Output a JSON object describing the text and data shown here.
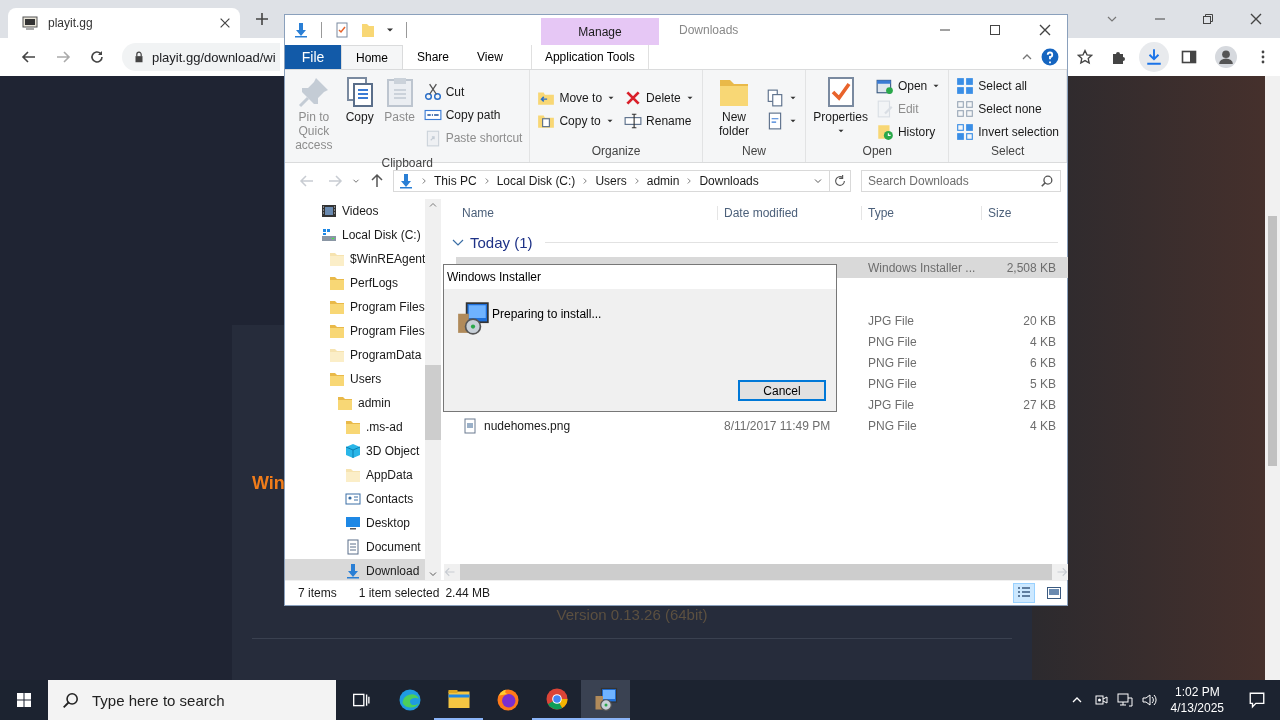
{
  "browser": {
    "tab": {
      "title": "playit.gg"
    },
    "url": "playit.gg/download/wi"
  },
  "web_page": {
    "heading": "Win",
    "version": "Version 0.13.26 (64bit)"
  },
  "explorer": {
    "title": "Downloads",
    "context_tab": "Manage",
    "ribbon_tabs": [
      {
        "label": "File",
        "kind": "file",
        "selected": false
      },
      {
        "label": "Home",
        "kind": "tab",
        "selected": true
      },
      {
        "label": "Share",
        "kind": "tab",
        "selected": false
      },
      {
        "label": "View",
        "kind": "tab",
        "selected": false
      },
      {
        "label": "Application Tools",
        "kind": "context",
        "selected": false
      }
    ],
    "ribbon_groups": [
      {
        "label": "Clipboard",
        "columns": [
          {
            "kind": "large",
            "items": [
              {
                "label": "Pin to Quick access",
                "disabled": true,
                "dropdown": false
              }
            ]
          },
          {
            "kind": "large",
            "items": [
              {
                "label": "Copy",
                "disabled": false,
                "dropdown": false
              }
            ]
          },
          {
            "kind": "large",
            "items": [
              {
                "label": "Paste",
                "disabled": true,
                "dropdown": false
              }
            ]
          },
          {
            "kind": "stack",
            "items": [
              {
                "label": "Cut",
                "disabled": false,
                "dropdown": false
              },
              {
                "label": "Copy path",
                "disabled": false,
                "dropdown": false
              },
              {
                "label": "Paste shortcut",
                "disabled": true,
                "dropdown": false
              }
            ]
          }
        ]
      },
      {
        "label": "Organize",
        "columns": [
          {
            "kind": "stack",
            "items": [
              {
                "label": "Move to",
                "disabled": false,
                "dropdown": true
              },
              {
                "label": "Copy to",
                "disabled": false,
                "dropdown": true
              }
            ]
          },
          {
            "kind": "stack",
            "items": [
              {
                "label": "Delete",
                "disabled": false,
                "dropdown": true
              },
              {
                "label": "Rename",
                "disabled": false,
                "dropdown": false
              }
            ]
          }
        ]
      },
      {
        "label": "New",
        "columns": [
          {
            "kind": "large",
            "items": [
              {
                "label": "New folder",
                "disabled": false,
                "dropdown": false
              }
            ]
          },
          {
            "kind": "stack",
            "items": [
              {
                "disabled": false,
                "dropdown": true
              },
              {
                "disabled": false,
                "dropdown": true
              }
            ]
          }
        ]
      },
      {
        "label": "Open",
        "columns": [
          {
            "kind": "large",
            "items": [
              {
                "label": "Properties",
                "disabled": false,
                "dropdown": true
              }
            ]
          },
          {
            "kind": "stack",
            "items": [
              {
                "label": "Open",
                "disabled": false,
                "dropdown": true
              },
              {
                "label": "Edit",
                "disabled": true,
                "dropdown": false
              },
              {
                "label": "History",
                "disabled": false,
                "dropdown": false
              }
            ]
          }
        ]
      },
      {
        "label": "Select",
        "columns": [
          {
            "kind": "stack",
            "items": [
              {
                "label": "Select all",
                "disabled": false,
                "dropdown": false
              },
              {
                "label": "Select none",
                "disabled": false,
                "dropdown": false
              },
              {
                "label": "Invert selection",
                "disabled": false,
                "dropdown": false
              }
            ]
          }
        ]
      }
    ],
    "address": {
      "crumbs": [
        "This PC",
        "Local Disk (C:)",
        "Users",
        "admin",
        "Downloads"
      ],
      "search_placeholder": "Search Downloads"
    },
    "nav_items": [
      {
        "label": "Videos",
        "kind": "videos",
        "selected": false
      },
      {
        "label": "Local Disk (C:)",
        "kind": "disk",
        "selected": false,
        "children": [
          {
            "label": "$WinREAgent",
            "kind": "hidden-folder",
            "selected": false
          },
          {
            "label": "PerfLogs",
            "kind": "folder",
            "selected": false
          },
          {
            "label": "Program Files",
            "kind": "folder",
            "selected": false
          },
          {
            "label": "Program Files",
            "kind": "folder",
            "selected": false
          },
          {
            "label": "ProgramData",
            "kind": "hidden-folder",
            "selected": false
          },
          {
            "label": "Users",
            "kind": "folder",
            "selected": false,
            "children": [
              {
                "label": "admin",
                "kind": "folder",
                "selected": false,
                "children": [
                  {
                    "label": ".ms-ad",
                    "kind": "folder",
                    "selected": false
                  },
                  {
                    "label": "3D Object",
                    "kind": "cube",
                    "selected": false
                  },
                  {
                    "label": "AppData",
                    "kind": "hidden-folder",
                    "selected": false
                  },
                  {
                    "label": "Contacts",
                    "kind": "contacts",
                    "selected": false
                  },
                  {
                    "label": "Desktop",
                    "kind": "desktop",
                    "selected": false
                  },
                  {
                    "label": "Document",
                    "kind": "document",
                    "selected": false
                  },
                  {
                    "label": "Download",
                    "kind": "download",
                    "selected": true
                  }
                ]
              }
            ]
          }
        ]
      }
    ],
    "columns": [
      "Name",
      "Date modified",
      "Type",
      "Size"
    ],
    "groups": [
      {
        "label": "Today (1)",
        "expanded": true,
        "rows": [
          {
            "type": "Windows Installer ...",
            "size": "2,508 KB",
            "selected": true
          }
        ]
      },
      {
        "rows": [
          {
            "type": "JPG File",
            "size": "20 KB",
            "selected": false
          },
          {
            "type": "PNG File",
            "size": "4 KB",
            "selected": false
          },
          {
            "type": "PNG File",
            "size": "6 KB",
            "selected": false
          },
          {
            "type": "PNG File",
            "size": "5 KB",
            "selected": false
          },
          {
            "type": "JPG File",
            "size": "27 KB",
            "selected": false
          },
          {
            "name": "nudehomes.png",
            "date": "8/11/2017 11:49 PM",
            "type": "PNG File",
            "size": "4 KB",
            "selected": false
          }
        ]
      }
    ],
    "status": {
      "count": "7 items",
      "selection": "1 item selected",
      "size": "2.44 MB"
    },
    "view_buttons": [
      {
        "kind": "details",
        "selected": true
      },
      {
        "kind": "tiles",
        "selected": false
      }
    ]
  },
  "dialog": {
    "title": "Windows Installer",
    "message": "Preparing to install...",
    "button": "Cancel"
  },
  "taskbar": {
    "search_placeholder": "Type here to search",
    "apps": [
      {
        "kind": "task-view",
        "running": false,
        "selected": false
      },
      {
        "kind": "edge",
        "running": false,
        "selected": false
      },
      {
        "kind": "explorer",
        "running": true,
        "selected": false
      },
      {
        "kind": "firefox",
        "running": false,
        "selected": false
      },
      {
        "kind": "chrome",
        "running": true,
        "selected": false
      },
      {
        "kind": "installer",
        "running": true,
        "selected": true
      }
    ],
    "time": "1:02 PM",
    "date": "4/13/2025"
  }
}
